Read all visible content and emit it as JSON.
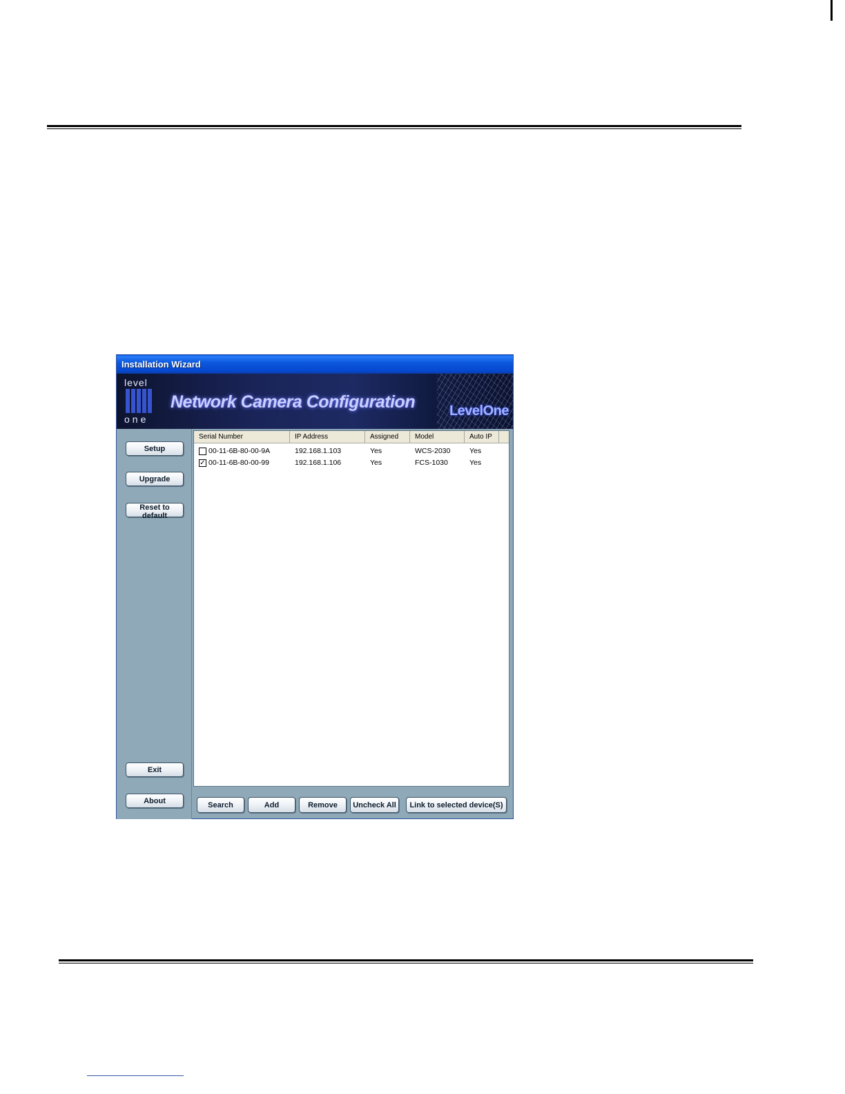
{
  "window": {
    "title": "Installation Wizard",
    "banner_title": "Network Camera Configuration",
    "brand": "LevelOne",
    "logo_top": "level",
    "logo_bottom": "one"
  },
  "sidebar": {
    "setup": "Setup",
    "upgrade": "Upgrade",
    "reset": "Reset to default",
    "exit": "Exit",
    "about": "About"
  },
  "device_table": {
    "columns": [
      "Serial Number",
      "IP Address",
      "Assigned",
      "Model",
      "Auto IP"
    ],
    "rows": [
      {
        "checked": false,
        "serial": "00-11-6B-80-00-9A",
        "ip": "192.168.1.103",
        "assigned": "Yes",
        "model": "WCS-2030",
        "auto_ip": "Yes"
      },
      {
        "checked": true,
        "serial": "00-11-6B-80-00-99",
        "ip": "192.168.1.106",
        "assigned": "Yes",
        "model": "FCS-1030",
        "auto_ip": "Yes"
      }
    ]
  },
  "actions": {
    "search": "Search",
    "add": "Add",
    "remove": "Remove",
    "uncheck_all": "Uncheck All",
    "link": "Link to selected device(S)"
  }
}
